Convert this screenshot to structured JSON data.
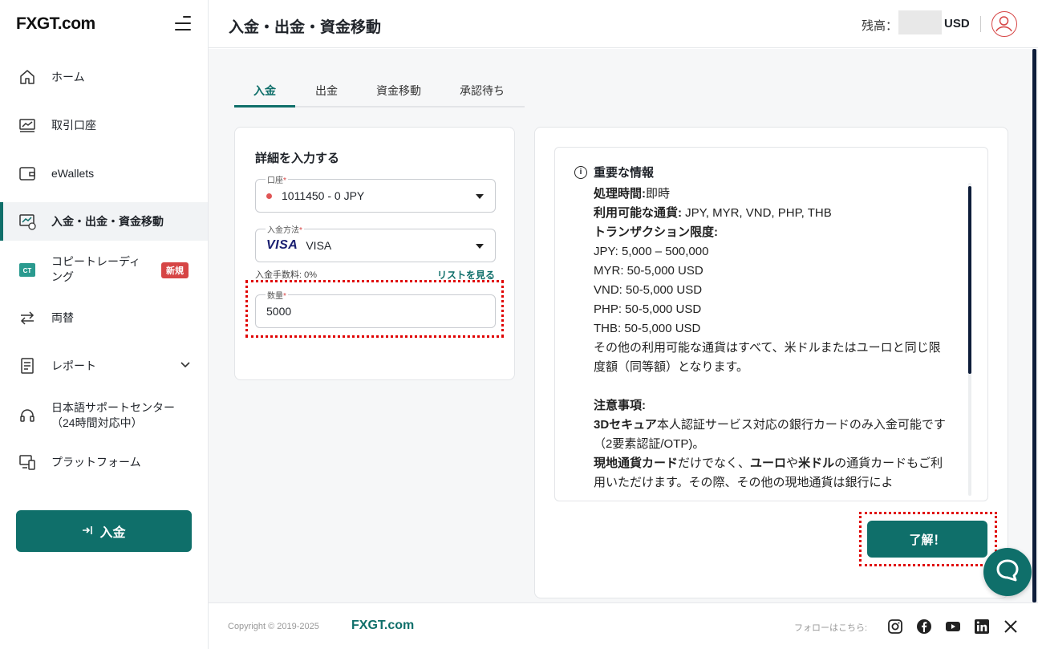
{
  "brand": {
    "logo_fx": "FX",
    "logo_gt": "GT",
    "logo_com": ".com",
    "accent": "#0f6f6a"
  },
  "sidebar": {
    "items": [
      {
        "label": "ホーム",
        "icon": "home-icon"
      },
      {
        "label": "取引口座",
        "icon": "trading-account-icon"
      },
      {
        "label": "eWallets",
        "icon": "wallet-icon"
      },
      {
        "label": "入金・出金・資金移動",
        "icon": "transfer-chart-icon"
      },
      {
        "label": "コピートレーディング",
        "icon": "ct-icon",
        "badge": "新規"
      },
      {
        "label": "両替",
        "icon": "exchange-icon"
      },
      {
        "label": "レポート",
        "icon": "report-icon"
      },
      {
        "label": "日本語サポートセンター（24時間対応中）",
        "icon": "support-headset-icon"
      },
      {
        "label": "プラットフォーム",
        "icon": "platform-icon"
      }
    ],
    "copy_trading_line1": "コピートレーディ",
    "copy_trading_line2": "ング",
    "support_line1": "日本語サポートセンター",
    "support_line2": "（24時間対応中）",
    "deposit_button": "入金",
    "ct_text": "CT"
  },
  "header": {
    "title": "入金・出金・資金移動",
    "balance_label": "残高：",
    "balance_currency": "USD"
  },
  "tabs": [
    "入金",
    "出金",
    "資金移動",
    "承認待ち"
  ],
  "form": {
    "title": "詳細を入力する",
    "account_label": "口座",
    "account_value": "1011450 - 0 JPY",
    "method_label": "入金方法",
    "method_logo": "VISA",
    "method_value": "VISA",
    "fee_text": "入金手数料: 0%",
    "list_link": "リストを見る",
    "amount_label": "数量",
    "amount_value": "5000",
    "required_mark": "*"
  },
  "info": {
    "heading": "重要な情報",
    "processing_label": "処理時間:",
    "processing_value": "即時",
    "currencies_label": "利用可能な通貨:",
    "currencies_value": " JPY, MYR, VND, PHP, THB",
    "limits_label": "トランザクション限度:",
    "limits": [
      "JPY: 5,000 – 500,000",
      "MYR: 50-5,000 USD",
      "VND: 50-5,000 USD",
      "PHP: 50-5,000 USD",
      "THB: 50-5,000 USD"
    ],
    "other_currencies": "その他の利用可能な通貨はすべて、米ドルまたはユーロと同じ限度額（同等額）となります。",
    "notes_label": "注意事項:",
    "note1_bold": "3Dセキュア",
    "note1_rest": "本人認証サービス対応の銀行カードのみ入金可能です（2要素認証/OTP)。",
    "note2_bold1": "現地通貨カード",
    "note2_mid1": "だけでなく、",
    "note2_bold2": "ユーロ",
    "note2_mid2": "や",
    "note2_bold3": "米ドル",
    "note2_rest": "の通貨カードもご利用いただけます。その際、その他の現地通貨は銀行によ"
  },
  "ok_button": "了解！",
  "footer": {
    "copyright": "Copyright © 2019-2025",
    "logo": "FXGT.com",
    "follow": "フォローはこちら:",
    "social": [
      "instagram-icon",
      "facebook-icon",
      "youtube-icon",
      "linkedin-icon",
      "x-icon"
    ]
  }
}
